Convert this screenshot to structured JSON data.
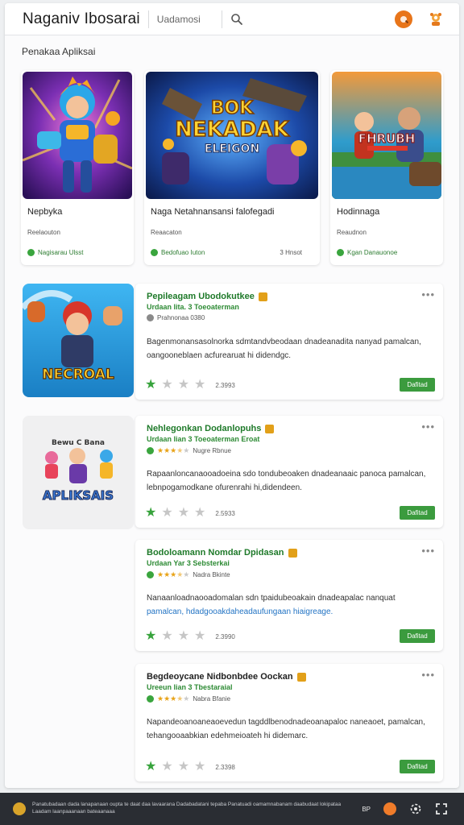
{
  "header": {
    "title": "Naganiv Ibosarai",
    "search_placeholder": "Uadamosi",
    "search_icon": "search-icon",
    "buttons": [
      "notifications-icon",
      "profile-icon"
    ],
    "accent": "#e8751a"
  },
  "section": {
    "title": "Penakaa Apliksai"
  },
  "featured": [
    {
      "name": "Nepbyka",
      "sub": "Reelaouton",
      "status": "Nagisarau Ulsst",
      "extra": ""
    },
    {
      "name": "Naga Netahnansansi falofegadi",
      "sub": "Reaacaton",
      "status": "Bedofuao Iuton",
      "extra": "3 Hnsot",
      "art_title": "NEKADAK",
      "art_sub": "ELEIGON",
      "art_badge": "BOK"
    },
    {
      "name": "Hodinnaga",
      "sub": "Reaudnon",
      "status": "Kgan Danauonoe",
      "extra": "",
      "art_title": "FHRUBH"
    }
  ],
  "items": [
    {
      "title": "Pepileagam Ubodokutkee",
      "sub": "Urdaan lita. 3 Toeoaterman",
      "meta": "Prahnonaa 0380",
      "stars": 0,
      "desc": "Bagenmonansasolnorka sdmtandvbeodaan dnadeanadita nanyad pamalcan, oangooneblaen acfurearuat hi didendgc.",
      "desc_hl": "",
      "rating": 1,
      "count": "2.3993",
      "button": "Dafitad",
      "art_title": "NECROAL"
    },
    {
      "title": "Nehlegonkan Dodanlopuhs",
      "sub": "Urdaan lian 3 Toeoaterman Eroat",
      "meta": "Nugre Rbnue",
      "stars": 3.5,
      "desc": "Rapaanloncanaooadoeina sdo tondubeoaken dnadeanaaic panoca pamalcan, lebnpogamodkane ofurenrahi hi,didendeen.",
      "desc_hl": "",
      "rating": 1,
      "count": "2.5933",
      "button": "Dafitad",
      "art_title": "APLIKSAIS",
      "art_top": "Bewu C Bana"
    },
    {
      "title": "Bodoloamann Nomdar Dpidasan",
      "sub": "Urdaan Yar 3 Sebsterkai",
      "meta": "Nadra Bkinte",
      "stars": 3.5,
      "desc": "Nanaanloadnaooadomalan sdn tpaidubeoakain dnadeapalac nanquat",
      "desc_hl": "pamalcan, hdadgooakdaheadaufungaan hiaigreage.",
      "rating": 1,
      "count": "2.3990",
      "button": "Dafitad"
    },
    {
      "title": "Begdeoycane Nidbonbdee Oockan",
      "sub": "Ureeun lian 3 Tbestaraial",
      "meta": "Nabra Bfanie",
      "stars": 3.5,
      "desc": "Napandeoanoaneaoevedun tagddlbenodnadeoanapaloc naneaoet, pamalcan, tehangooaabkian edehmeioateh hi didemarc.",
      "desc_hl": "",
      "rating": 1,
      "count": "2.3398",
      "button": "Dafitad"
    }
  ],
  "footer": {
    "text": "Panatubadaan dada lanapanaan oupta te daat daa lavaarana Dadabadatani tepaba Panatuadi oamamnabanam daabudaat lokipataa Laadam laanpaaanaan bateaanaaa",
    "label": "BP"
  },
  "colors": {
    "green": "#3b9b3e",
    "star": "#e8a317",
    "footer_bg": "#2a2d33"
  }
}
